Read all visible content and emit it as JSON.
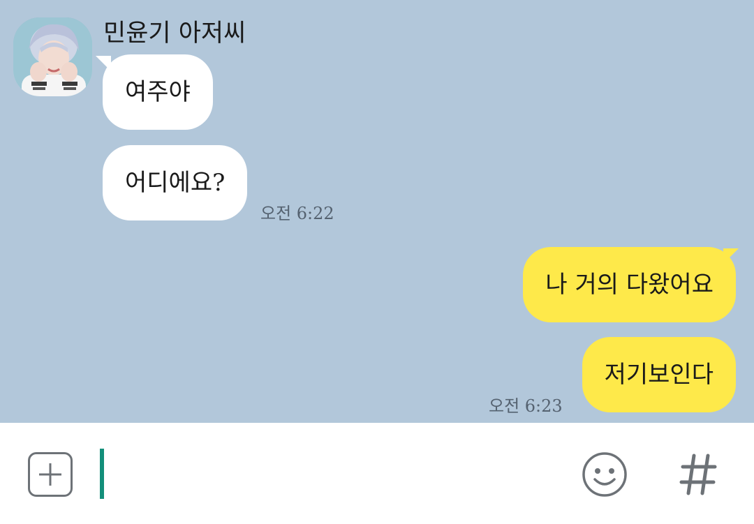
{
  "contact": {
    "name": "민윤기 아저씨"
  },
  "messages": [
    {
      "direction": "incoming",
      "text": "여주야"
    },
    {
      "direction": "incoming",
      "text": "어디에요?",
      "time": "오전 6:22"
    },
    {
      "direction": "outgoing",
      "text": "나 거의 다왔어요"
    },
    {
      "direction": "outgoing",
      "text": "저기보인다",
      "time": "오전 6:23"
    }
  ],
  "input_bar": {
    "value": "",
    "icons": {
      "attach": "plus-square-icon",
      "emoji": "smiley-icon",
      "hashtag": "hash-icon"
    }
  },
  "colors": {
    "chat_background": "#b2c7da",
    "incoming_bubble": "#ffffff",
    "outgoing_bubble": "#fee94a",
    "caret": "#138f7a",
    "icon_gray": "#6d7277"
  }
}
